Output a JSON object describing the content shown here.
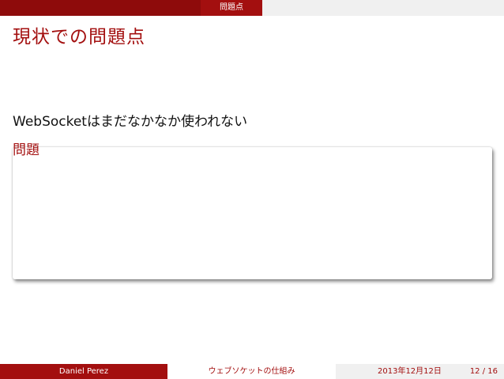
{
  "header": {
    "section": "問題点"
  },
  "frame": {
    "title": "現状での問題点",
    "body_text": "WebSocketはまだなかなか使われない",
    "block_title": "問題"
  },
  "footer": {
    "author": "Daniel Perez",
    "talk_title": "ウェブソケットの仕組み",
    "date": "2013年12月12日",
    "page": "12 / 16"
  },
  "colors": {
    "accent": "#a30f0f",
    "dark_accent": "#8e0b0b",
    "light_gray": "#f0f0f0"
  }
}
